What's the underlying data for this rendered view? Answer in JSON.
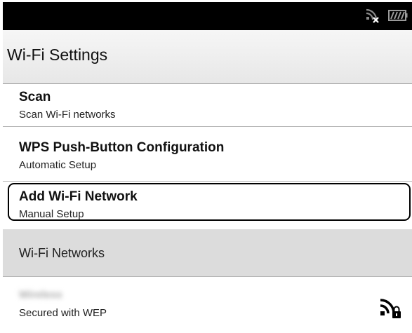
{
  "status_bar": {
    "icons": [
      "wifi-disconnected-icon",
      "battery-icon"
    ]
  },
  "header": {
    "title": "Wi-Fi Settings"
  },
  "menu": [
    {
      "title": "Scan",
      "subtitle": "Scan Wi-Fi networks"
    },
    {
      "title": "WPS Push-Button Configuration",
      "subtitle": "Automatic Setup"
    },
    {
      "title": "Add Wi-Fi Network",
      "subtitle": "Manual Setup",
      "selected": true
    }
  ],
  "networks_section": {
    "label": "Wi-Fi Networks"
  },
  "networks": [
    {
      "name": "Wireless",
      "security": "Secured with WEP",
      "icon": "secured-wifi-icon"
    }
  ]
}
